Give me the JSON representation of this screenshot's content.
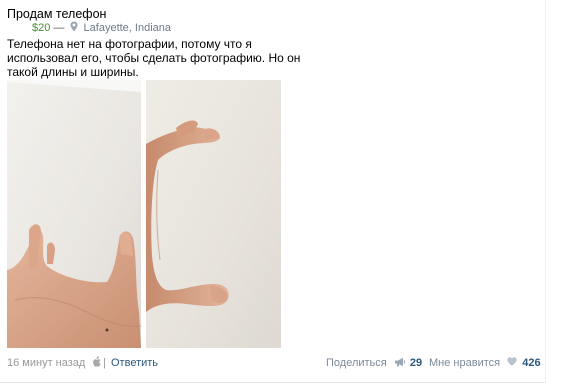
{
  "post": {
    "title": "Продам телефон",
    "price": "$20",
    "separator": "—",
    "location_icon": "location-pin-icon",
    "location": "Lafayette, Indiana",
    "description": "Телефона нет на фотографии, потому что я использовал его, чтобы сделать фотографию. Но он такой длины и ширины.",
    "photos": [
      {
        "alt": "left-photo"
      },
      {
        "alt": "right-photo"
      }
    ]
  },
  "footer": {
    "time": "16 минут назад",
    "platform_icon": "apple-icon",
    "divider": "|",
    "reply_label": "Ответить",
    "share_label": "Поделиться",
    "share_icon": "megaphone-icon",
    "share_count": "29",
    "like_label": "Мне нравится",
    "like_icon": "heart-icon",
    "like_count": "426"
  },
  "colors": {
    "price": "#4a8c2e",
    "link": "#2b587a",
    "muted": "#999999",
    "action": "#7d8a99"
  }
}
